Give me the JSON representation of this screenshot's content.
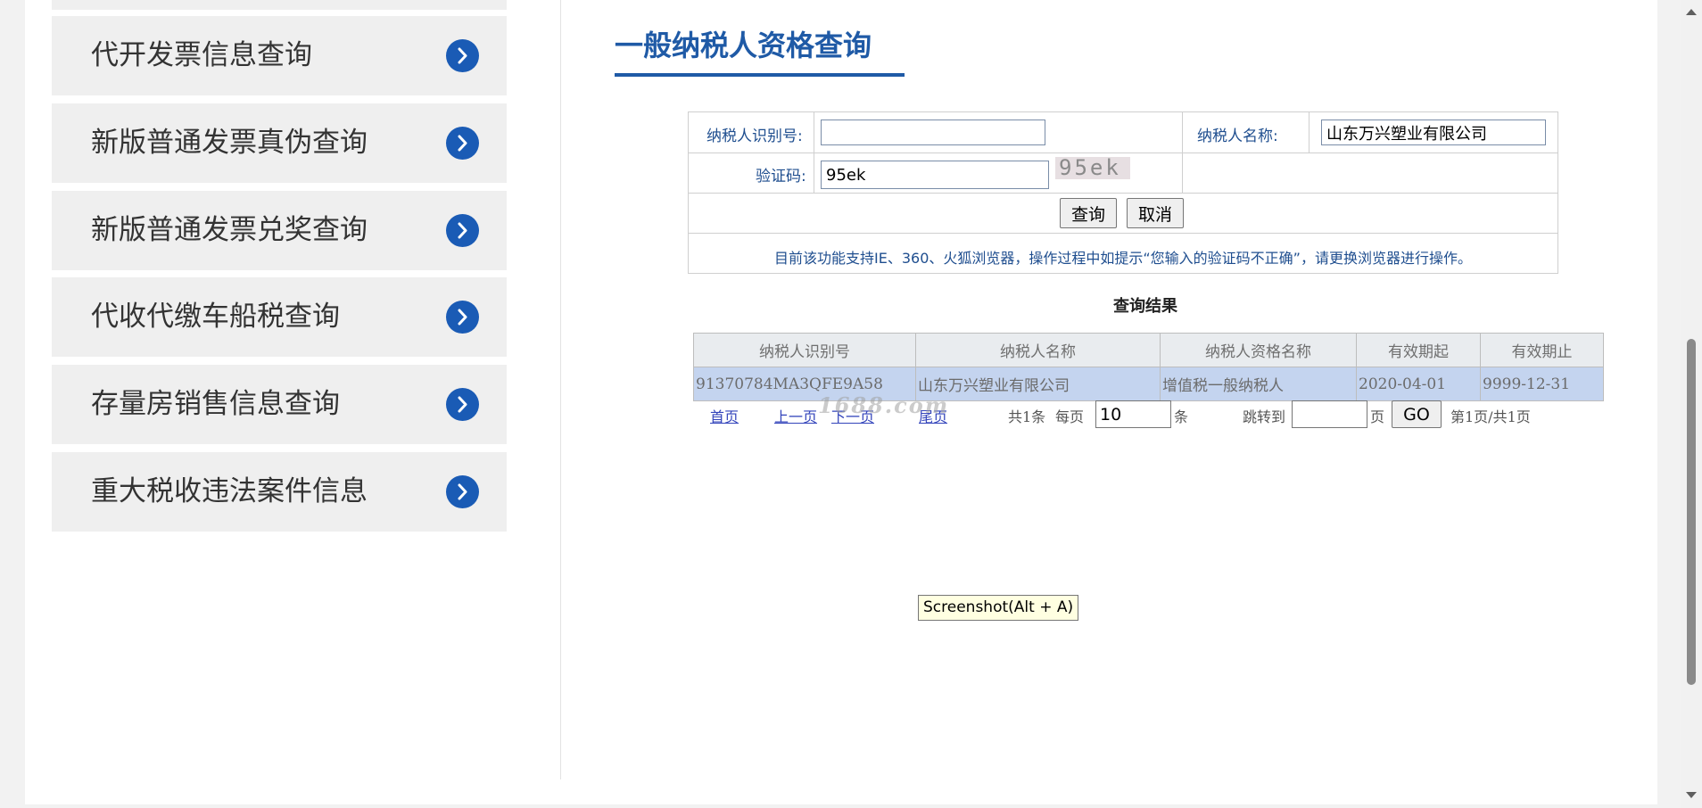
{
  "sidebar": {
    "items": [
      {
        "label": "代开发票信息查询"
      },
      {
        "label": "新版普通发票真伪查询"
      },
      {
        "label": "新版普通发票兑奖查询"
      },
      {
        "label": "代收代缴车船税查询"
      },
      {
        "label": "存量房销售信息查询"
      },
      {
        "label": "重大税收违法案件信息"
      }
    ]
  },
  "main": {
    "title": "一般纳税人资格查询"
  },
  "form": {
    "taxpayer_id_label": "纳税人识别号:",
    "taxpayer_id_value": "",
    "taxpayer_name_label": "纳税人名称:",
    "taxpayer_name_value": "山东万兴塑业有限公司",
    "captcha_label": "验证码:",
    "captcha_value": "95ek",
    "captcha_image_text": "95ek",
    "query_button": "查询",
    "cancel_button": "取消",
    "notice": "目前该功能支持IE、360、火狐浏览器，操作过程中如提示“您输入的验证码不正确”，请更换浏览器进行操作。"
  },
  "results": {
    "title": "查询结果",
    "columns": [
      "纳税人识别号",
      "纳税人名称",
      "纳税人资格名称",
      "有效期起",
      "有效期止"
    ],
    "rows": [
      [
        "91370784MA3QFE9A58",
        "山东万兴塑业有限公司",
        "增值税一般纳税人",
        "2020-04-01",
        "9999-12-31"
      ]
    ]
  },
  "pager": {
    "first": "首页",
    "prev": "上一页",
    "next": "下一页",
    "last": "尾页",
    "total": "共1条",
    "per_page_label": "每页",
    "per_page_value": "10",
    "per_page_unit": "条",
    "jump_label": "跳转到",
    "jump_value": "",
    "jump_unit": "页",
    "go_button": "GO",
    "page_info": "第1页/共1页"
  },
  "watermark": "1688.com",
  "tooltip": "Screenshot(Alt + A)"
}
